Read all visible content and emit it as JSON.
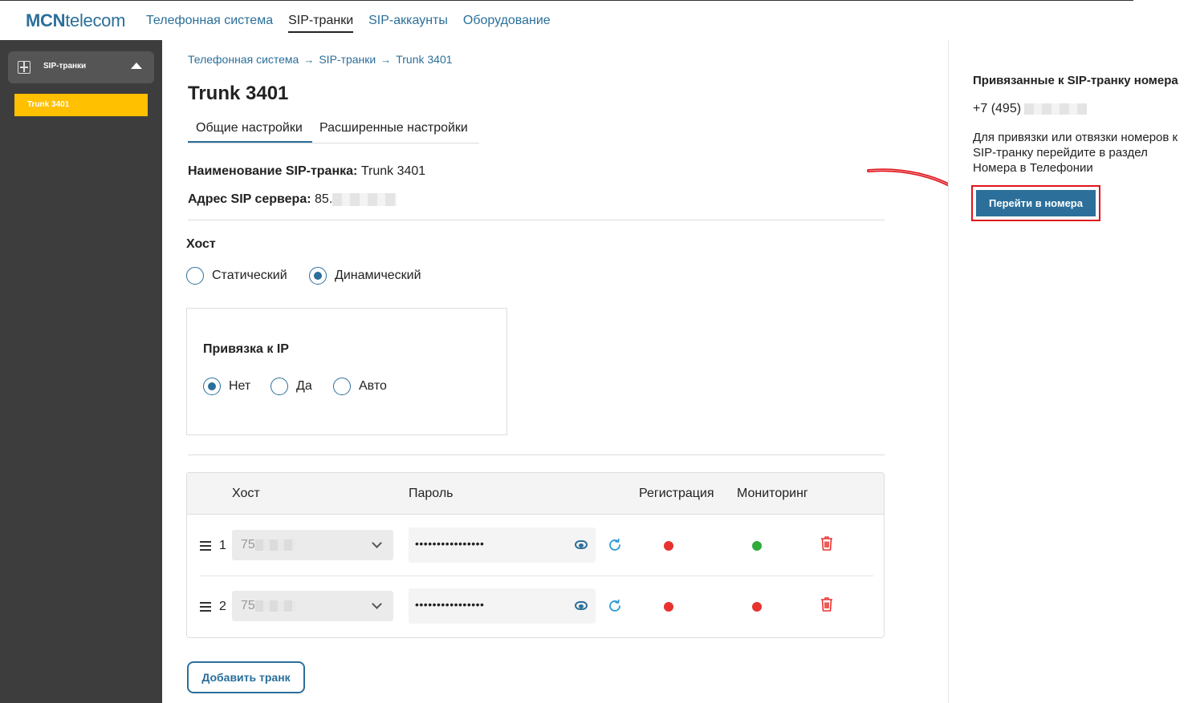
{
  "logo": {
    "bold": "MCN",
    "rest": "telecom"
  },
  "nav": [
    "Телефонная система",
    "SIP-транки",
    "SIP-аккаунты",
    "Оборудование"
  ],
  "nav_active_index": 1,
  "sidebar": {
    "group_label": "SIP-транки",
    "items": [
      {
        "label": "Trunk 3401",
        "active": true
      }
    ]
  },
  "breadcrumb": [
    "Телефонная система",
    "SIP-транки",
    "Trunk 3401"
  ],
  "page_title": "Trunk 3401",
  "tabs": [
    "Общие настройки",
    "Расширенные настройки"
  ],
  "fields": {
    "name_label": "Наименование SIP-транка:",
    "name_value": "Trunk 3401",
    "server_label": "Адрес SIP сервера:",
    "server_value": "85."
  },
  "host": {
    "label": "Хост",
    "options": [
      "Статический",
      "Динамический"
    ],
    "selected": "Динамический"
  },
  "ip_binding": {
    "label": "Привязка к IP",
    "options": [
      "Нет",
      "Да",
      "Авто"
    ],
    "selected": "Нет"
  },
  "table": {
    "headers": [
      "Хост",
      "Пароль",
      "Регистрация",
      "Мониторинг"
    ],
    "rows": [
      {
        "num": "1",
        "host": "75",
        "password": "••••••••••••••••",
        "registration": "red",
        "monitoring": "green"
      },
      {
        "num": "2",
        "host": "75",
        "password": "••••••••••••••••",
        "registration": "red",
        "monitoring": "red"
      }
    ]
  },
  "add_button": "Добавить транк",
  "right_panel": {
    "title": "Привязанные к SIP-транку номера",
    "phone_prefix": "+7 (495)",
    "text": "Для привязки или отвязки номеров к SIP-транку перейдите в раздел Номера в Телефонии",
    "button": "Перейти в номера"
  },
  "colors": {
    "accent": "#2b6f9a",
    "sidebar_bg": "#3d3d3d",
    "sidebar_active": "#ffc000",
    "status_red": "#e8322f",
    "status_green": "#2faa3b",
    "highlight": "#e0141c"
  }
}
